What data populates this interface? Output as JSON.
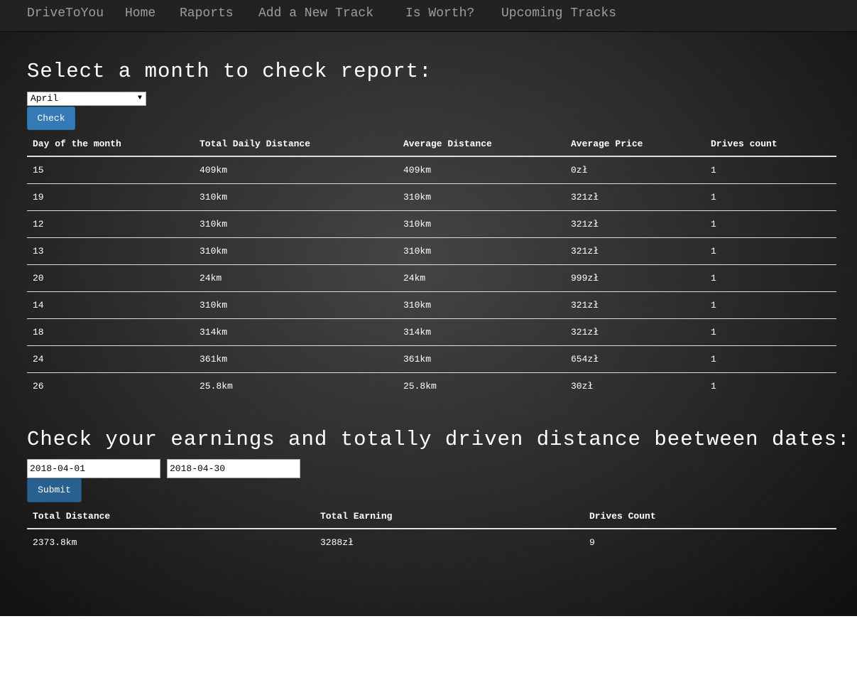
{
  "navbar": {
    "brand": "DriveToYou",
    "links": [
      "Home",
      "Raports",
      "Add a New Track",
      "Is Worth?",
      "Upcoming Tracks"
    ]
  },
  "monthly_report": {
    "heading": "Select a month to check report:",
    "selected_month": "April",
    "check_label": "Check",
    "columns": [
      "Day of the month",
      "Total Daily Distance",
      "Average Distance",
      "Average Price",
      "Drives count"
    ],
    "rows": [
      [
        "15",
        "409km",
        "409km",
        "0zł",
        "1"
      ],
      [
        "19",
        "310km",
        "310km",
        "321zł",
        "1"
      ],
      [
        "12",
        "310km",
        "310km",
        "321zł",
        "1"
      ],
      [
        "13",
        "310km",
        "310km",
        "321zł",
        "1"
      ],
      [
        "20",
        "24km",
        "24km",
        "999zł",
        "1"
      ],
      [
        "14",
        "310km",
        "310km",
        "321zł",
        "1"
      ],
      [
        "18",
        "314km",
        "314km",
        "321zł",
        "1"
      ],
      [
        "24",
        "361km",
        "361km",
        "654zł",
        "1"
      ],
      [
        "26",
        "25.8km",
        "25.8km",
        "30zł",
        "1"
      ]
    ]
  },
  "earnings": {
    "heading": "Check your earnings and totally driven distance beetween dates:",
    "date_from": "2018-04-01",
    "date_to": "2018-04-30",
    "submit_label": "Submit",
    "columns": [
      "Total Distance",
      "Total Earning",
      "Drives Count"
    ],
    "rows": [
      [
        "2373.8km",
        "3288zł",
        "9"
      ]
    ]
  },
  "colors": {
    "navbar_bg": "#222222",
    "nav_text": "#9d9d9d",
    "button_primary": "#337ab7",
    "background": "#2a2a2a"
  }
}
